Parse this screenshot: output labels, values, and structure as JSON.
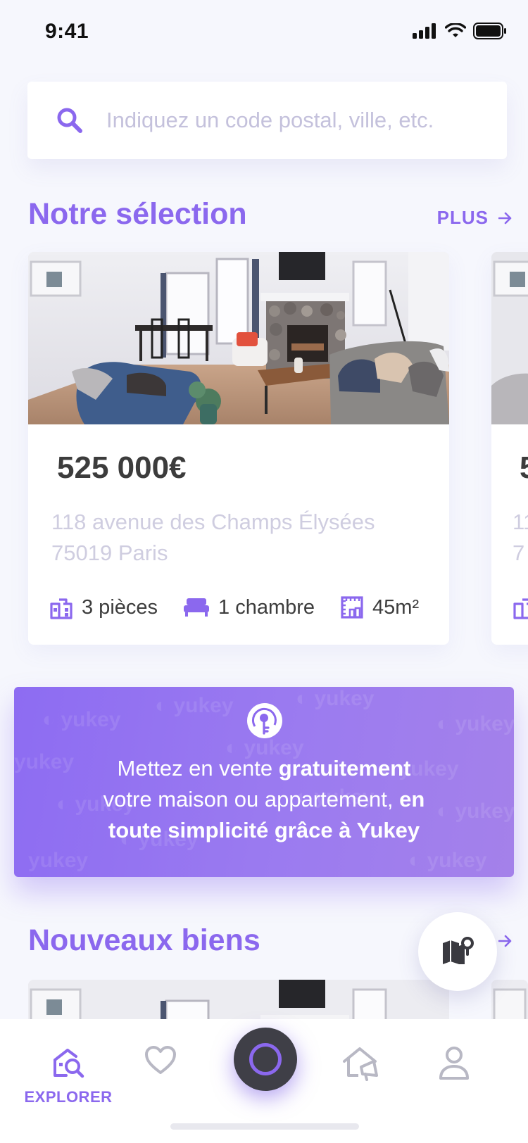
{
  "status_bar": {
    "time": "9:41"
  },
  "search": {
    "placeholder": "Indiquez un code postal, ville, etc."
  },
  "selection": {
    "title": "Notre sélection",
    "more_label": "PLUS",
    "cards": [
      {
        "price": "525 000€",
        "address_line1": "118 avenue des Champs Élysées",
        "address_line2": "75019 Paris",
        "rooms": "3 pièces",
        "bedrooms": "1 chambre",
        "area": "45m²"
      },
      {
        "price": "5",
        "address_line1": "11",
        "address_line2": "7"
      }
    ]
  },
  "promo": {
    "text_1": "Mettez en vente ",
    "bold_1": "gratuitement",
    "text_2": "votre maison ou appartement, ",
    "bold_2": "en",
    "bold_3": "toute simplicité grâce à Yukey",
    "watermark": "yukey"
  },
  "new_listings": {
    "title": "Nouveaux biens"
  },
  "tab_bar": {
    "explore_label": "EXPLORER",
    "items": [
      {
        "name": "explorer",
        "icon": "search-home-icon",
        "active": true
      },
      {
        "name": "favorites",
        "icon": "heart-icon"
      },
      {
        "name": "center",
        "icon": "ring-icon"
      },
      {
        "name": "sell",
        "icon": "home-megaphone-icon"
      },
      {
        "name": "profile",
        "icon": "user-icon"
      }
    ]
  },
  "colors": {
    "accent": "#8b68ee",
    "background": "#f6f7fd",
    "text_dark": "#3c3c3c",
    "muted": "#cfcde0"
  }
}
